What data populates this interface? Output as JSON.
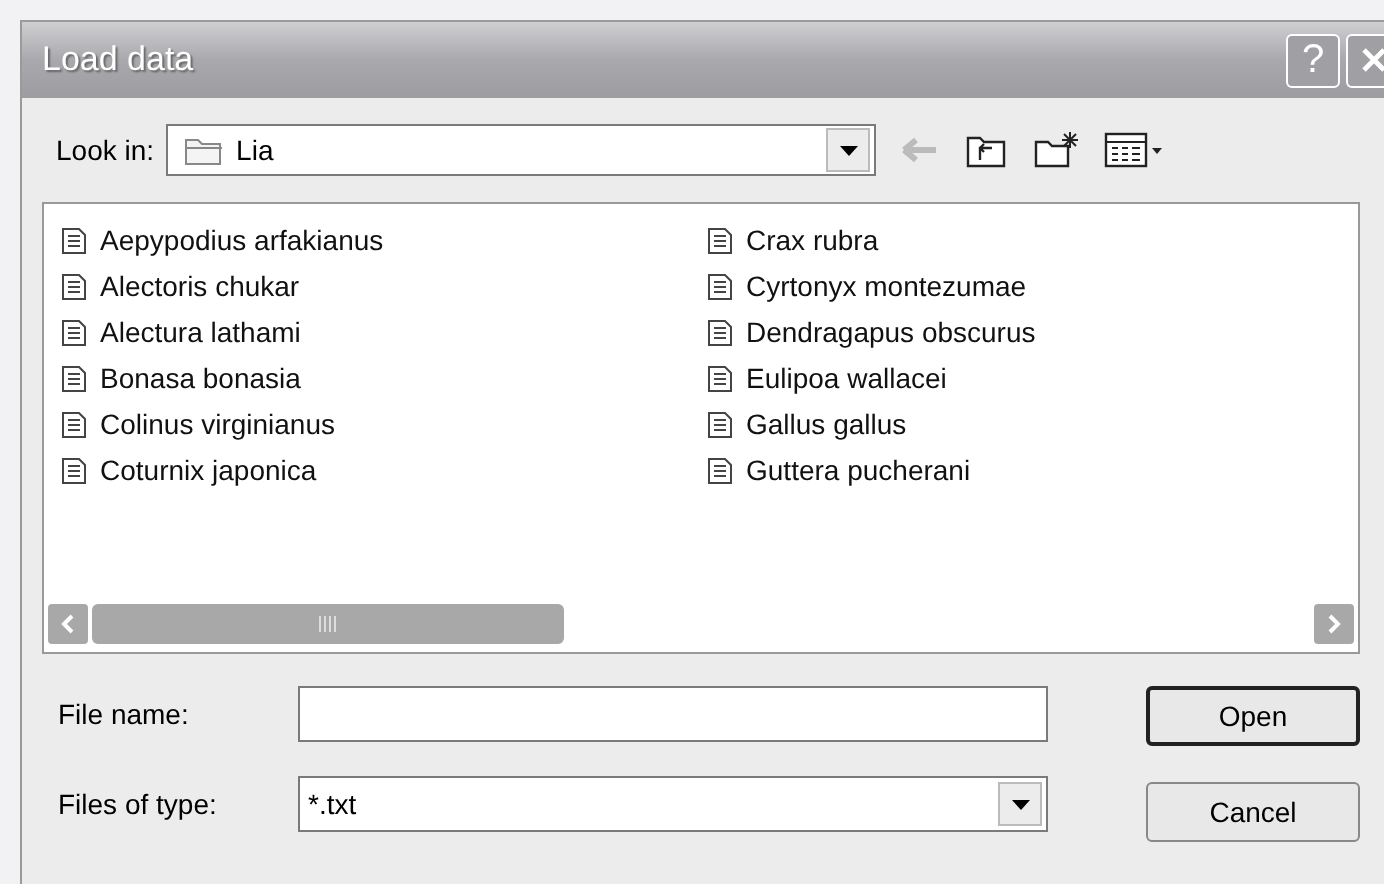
{
  "window": {
    "title": "Load data",
    "help_button": "?"
  },
  "look_in": {
    "label": "Look in:",
    "value": "Lia"
  },
  "files": [
    {
      "name": "Aepypodius arfakianus"
    },
    {
      "name": "Alectoris chukar"
    },
    {
      "name": "Alectura lathami"
    },
    {
      "name": "Bonasa bonasia"
    },
    {
      "name": "Colinus virginianus"
    },
    {
      "name": "Coturnix japonica"
    },
    {
      "name": "Crax rubra"
    },
    {
      "name": "Cyrtonyx montezumae"
    },
    {
      "name": "Dendragapus obscurus"
    },
    {
      "name": "Eulipoa wallacei"
    },
    {
      "name": "Gallus gallus"
    },
    {
      "name": "Guttera pucherani"
    }
  ],
  "file_name": {
    "label": "File name:"
  },
  "file_type": {
    "label": "Files of type:",
    "value": "*.txt"
  },
  "buttons": [
    {
      "label": "Open",
      "default": true
    },
    {
      "label": "Cancel",
      "default": false
    }
  ]
}
